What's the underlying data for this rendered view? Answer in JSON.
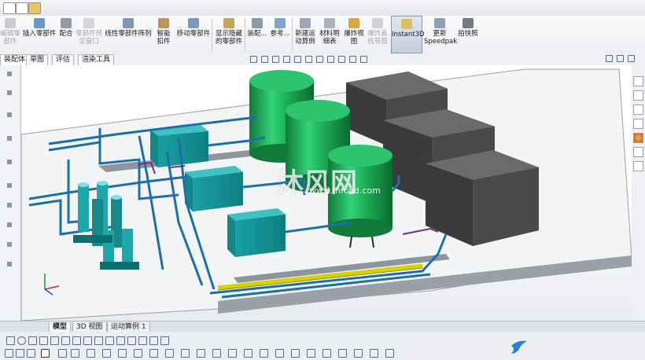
{
  "ribbon": {
    "buttons": [
      {
        "label": "编辑零部件",
        "enabled": false
      },
      {
        "label": "插入零部件",
        "enabled": true
      },
      {
        "label": "配合",
        "enabled": true
      },
      {
        "label": "零部件预览窗口",
        "enabled": false
      },
      {
        "label": "线性零部件阵列",
        "enabled": true
      },
      {
        "label": "智能扣件",
        "enabled": true
      },
      {
        "label": "移动零部件",
        "enabled": true
      },
      {
        "label": "显示隐藏的零部件",
        "enabled": true
      },
      {
        "label": "装配...",
        "enabled": true
      },
      {
        "label": "参考...",
        "enabled": true
      },
      {
        "label": "新建运动算例",
        "enabled": true
      },
      {
        "label": "材料明细表",
        "enabled": true
      },
      {
        "label": "爆炸视图",
        "enabled": true
      },
      {
        "label": "爆炸直线草图",
        "enabled": false
      },
      {
        "label": "Instant3D",
        "enabled": true,
        "active": true
      },
      {
        "label": "更新Speedpak",
        "enabled": true
      },
      {
        "label": "拍快照",
        "enabled": true
      }
    ]
  },
  "tabs": [
    "装配体",
    "草图",
    "评估",
    "渲染工具"
  ],
  "bottom_tabs": [
    "模型",
    "3D 视图",
    "运动算例 1"
  ],
  "watermark": {
    "text": "沐风网",
    "url": "www.mfcad.com"
  },
  "colors": {
    "tank": "#1fb35a",
    "box": "#4a4a4a",
    "pipe": "#1e6fa8",
    "tank_equipment": "#1fa6a8",
    "yellow_pipe": "#d6d200",
    "ribbon_bg": "#eceef1"
  },
  "icons": [
    "camera-icon",
    "gear-icon",
    "triad-icon",
    "view-orientation-icon",
    "appearance-icon"
  ]
}
